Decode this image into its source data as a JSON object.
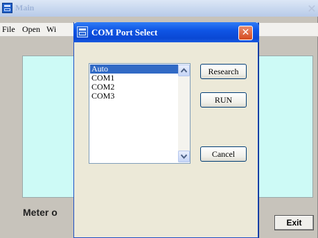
{
  "main": {
    "title": "Main",
    "menu": [
      "File",
      "Open",
      "Wi"
    ],
    "status_label": "Meter o",
    "exit_label": "Exit"
  },
  "dialog": {
    "title": "COM Port Select",
    "ports": [
      "Auto",
      "COM1",
      "COM2",
      "COM3"
    ],
    "selected_index": 0,
    "buttons": {
      "research": "Research",
      "run": "RUN",
      "cancel": "Cancel"
    }
  },
  "icons": {
    "main_window": "app-window-icon",
    "dialog": "app-window-icon",
    "close": "close-icon",
    "scroll_up": "chevron-up-icon",
    "scroll_down": "chevron-down-icon"
  },
  "colors": {
    "titlebar_blue": "#0f55e5",
    "close_red": "#d64a1e",
    "content_bg": "#cdfaf6",
    "selection": "#316ac5"
  }
}
